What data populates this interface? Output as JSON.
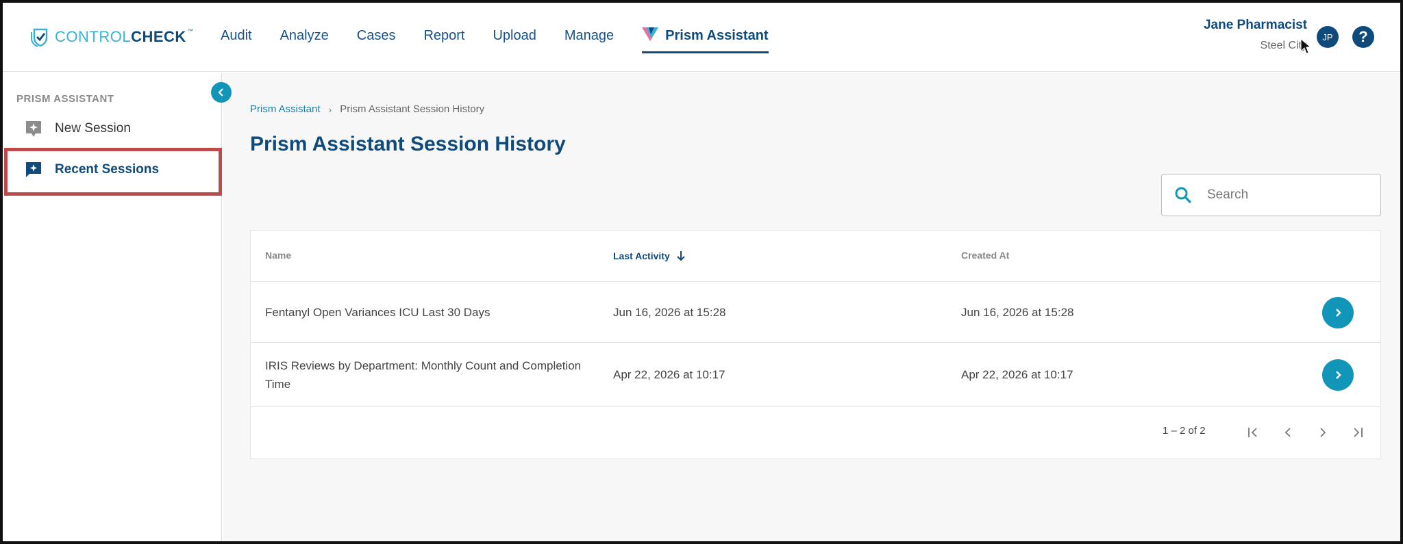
{
  "header": {
    "logo": {
      "light": "CONTROL",
      "bold": "CHECK",
      "tm": "™"
    },
    "nav": [
      "Audit",
      "Analyze",
      "Cases",
      "Report",
      "Upload",
      "Manage"
    ],
    "active_nav": "Prism Assistant",
    "user_name": "Jane Pharmacist",
    "user_site": "Steel City",
    "avatar_initials": "JP",
    "help_glyph": "?"
  },
  "sidebar": {
    "heading": "PRISM ASSISTANT",
    "items": [
      {
        "label": "New Session",
        "icon": "chat-sparkle-icon"
      },
      {
        "label": "Recent Sessions",
        "icon": "chat-sparkle-icon",
        "active": true
      }
    ]
  },
  "main": {
    "breadcrumb": [
      "Prism Assistant",
      "Prism Assistant Session History"
    ],
    "title": "Prism Assistant Session History",
    "search": {
      "placeholder": "Search",
      "value": ""
    },
    "table": {
      "columns": [
        "Name",
        "Last Activity",
        "Created At"
      ],
      "sorted_column": "Last Activity",
      "sort_direction": "descending",
      "rows": [
        {
          "name": "Fentanyl Open Variances ICU Last 30 Days",
          "last_activity": "Jun 16, 2026 at 15:28",
          "created_at": "Jun 16, 2026 at 15:28"
        },
        {
          "name": "IRIS Reviews by Department: Monthly Count and Completion Time",
          "last_activity": "Apr 22, 2026 at 10:17",
          "created_at": "Apr 22, 2026 at 10:17"
        }
      ]
    },
    "pagination": {
      "range": "1 – 2 of 2"
    }
  },
  "colors": {
    "brand_navy": "#0f4a7c",
    "brand_cyan": "#39b2d6",
    "action_teal": "#1195b8",
    "highlight_red": "#c0494b"
  }
}
